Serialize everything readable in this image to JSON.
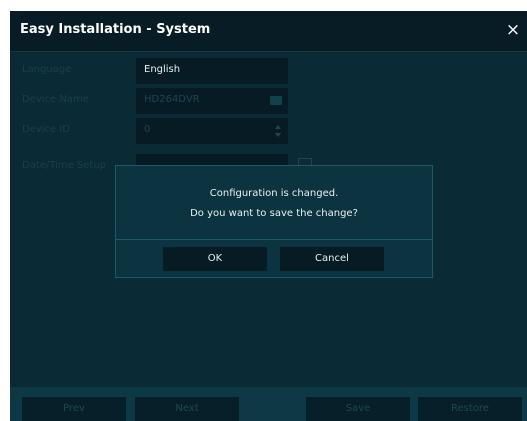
{
  "window": {
    "title": "Easy Installation - System",
    "close_glyph": "×"
  },
  "form": {
    "rows": [
      {
        "label": "Language",
        "value": "English"
      },
      {
        "label": "Device Name",
        "value": "HD264DVR",
        "icon": "keyboard-icon"
      },
      {
        "label": "Device ID",
        "value": "0",
        "icon": "spinner-arrows-icon"
      },
      {
        "label": "Date/Time Setup",
        "value": ""
      }
    ]
  },
  "dialog": {
    "line1": "Configuration is changed.",
    "line2": "Do you want to save the change?",
    "ok_label": "OK",
    "cancel_label": "Cancel"
  },
  "bottom_bar": {
    "prev_label": "Prev",
    "next_label": "Next",
    "save_label": "Save",
    "restore_label": "Restore"
  },
  "colors": {
    "background": "#0a2a35",
    "titlebar": "#071c24",
    "field": "#061b23",
    "dialog": "#0b3340",
    "dialog_border": "#1d5a67"
  }
}
